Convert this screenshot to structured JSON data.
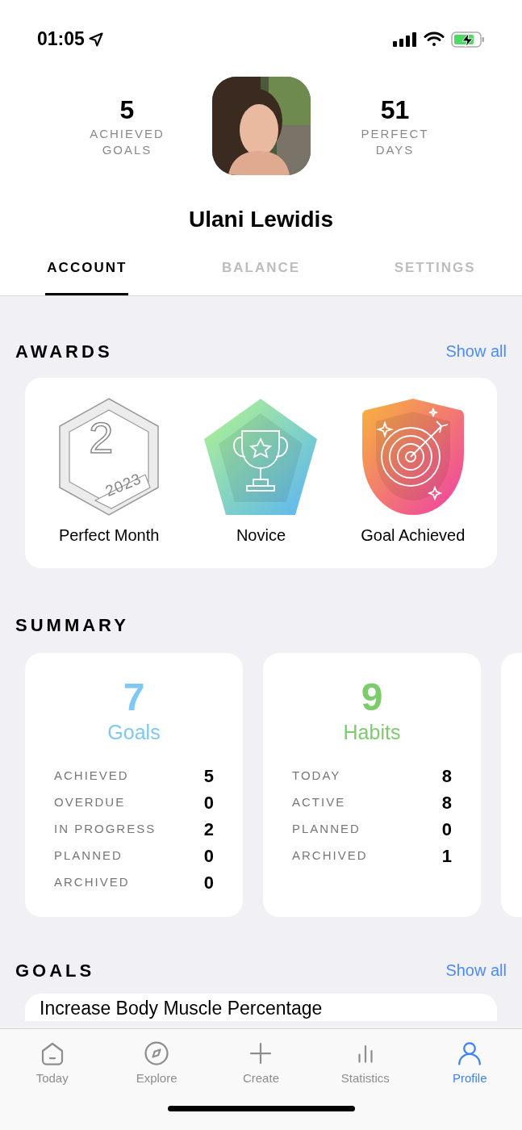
{
  "status_bar": {
    "time": "01:05"
  },
  "profile": {
    "stats": [
      {
        "value": "5",
        "label": "ACHIEVED GOALS"
      },
      {
        "value": "51",
        "label": "PERFECT DAYS"
      }
    ],
    "name": "Ulani Lewidis"
  },
  "tabs": [
    {
      "label": "ACCOUNT",
      "selected": true
    },
    {
      "label": "BALANCE",
      "selected": false
    },
    {
      "label": "SETTINGS",
      "selected": false
    }
  ],
  "awards": {
    "title": "AWARDS",
    "link": "Show all",
    "items": [
      {
        "kind": "hexagon",
        "number": "2",
        "year": "2023",
        "label": "Perfect Month"
      },
      {
        "kind": "trophy",
        "label": "Novice"
      },
      {
        "kind": "target",
        "label": "Goal Achieved"
      }
    ]
  },
  "summary": {
    "title": "SUMMARY",
    "cards": [
      {
        "count": "7",
        "name": "Goals",
        "color": "#7fc8f5",
        "rows": [
          {
            "label": "ACHIEVED",
            "value": "5"
          },
          {
            "label": "OVERDUE",
            "value": "0"
          },
          {
            "label": "IN PROGRESS",
            "value": "2"
          },
          {
            "label": "PLANNED",
            "value": "0"
          },
          {
            "label": "ARCHIVED",
            "value": "0"
          }
        ]
      },
      {
        "count": "9",
        "name": "Habits",
        "color": "#7ccc6c",
        "rows": [
          {
            "label": "TODAY",
            "value": "8"
          },
          {
            "label": "ACTIVE",
            "value": "8"
          },
          {
            "label": "PLANNED",
            "value": "0"
          },
          {
            "label": "ARCHIVED",
            "value": "1"
          }
        ]
      }
    ]
  },
  "goals": {
    "title": "GOALS",
    "link": "Show all",
    "items": [
      {
        "title": "Increase Body Muscle Percentage"
      }
    ]
  },
  "nav": [
    {
      "kind": "today",
      "label": "Today",
      "selected": false
    },
    {
      "kind": "explore",
      "label": "Explore",
      "selected": false
    },
    {
      "kind": "create",
      "label": "Create",
      "selected": false
    },
    {
      "kind": "statistics",
      "label": "Statistics",
      "selected": false
    },
    {
      "kind": "profile",
      "label": "Profile",
      "selected": true
    }
  ]
}
